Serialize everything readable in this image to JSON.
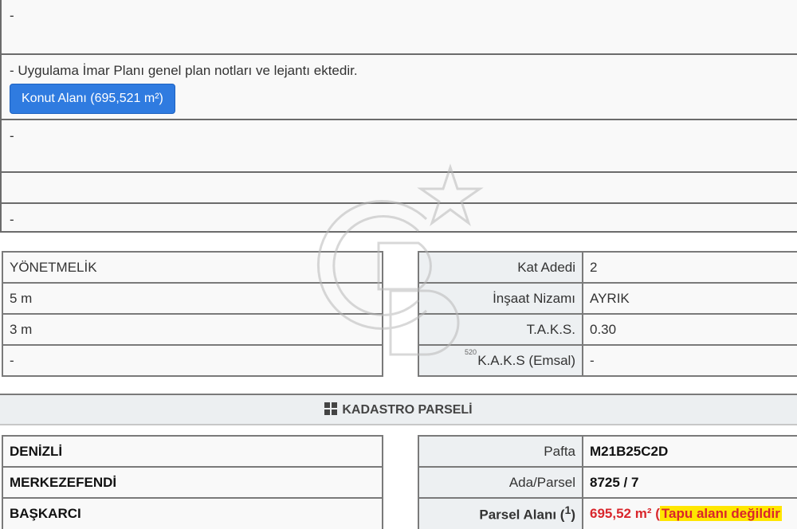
{
  "notes": {
    "row1": "-",
    "row2_text": "- Uygulama İmar Planı genel plan notları ve lejantı ektedir.",
    "zone_button": "Konut Alanı (695,521 m²)",
    "row3": "-",
    "row4": "",
    "row5": "-"
  },
  "rules": {
    "left": [
      "YÖNETMELİK",
      "5 m",
      "3 m",
      "-"
    ],
    "right": [
      {
        "label": "Kat Adedi",
        "value": "2"
      },
      {
        "label": "İnşaat Nizamı",
        "value": "AYRIK"
      },
      {
        "label": "T.A.K.S.",
        "value": "0.30"
      },
      {
        "label": "K.A.K.S (Emsal)",
        "value": "-"
      }
    ]
  },
  "section": {
    "title": "KADASTRO PARSELİ",
    "icon": "grid-icon"
  },
  "kadastro": {
    "left": [
      "DENİZLİ",
      "MERKEZEFENDİ",
      "BAŞKARCI"
    ],
    "right": [
      {
        "label": "Pafta",
        "value": "M21B25C2D"
      },
      {
        "label": "Ada/Parsel",
        "value": "8725 / 7"
      }
    ],
    "area_label": "Parsel Alanı (",
    "area_sup": "1",
    "area_label_end": ")",
    "area_value": "695,52 m² (",
    "area_warning": "Tapu alanı değildir"
  },
  "watermark": {
    "tiny_text": "520"
  },
  "colors": {
    "accent_blue": "#2f7be0",
    "warning_red": "#d9262c",
    "highlight_yellow": "#ffe600"
  }
}
